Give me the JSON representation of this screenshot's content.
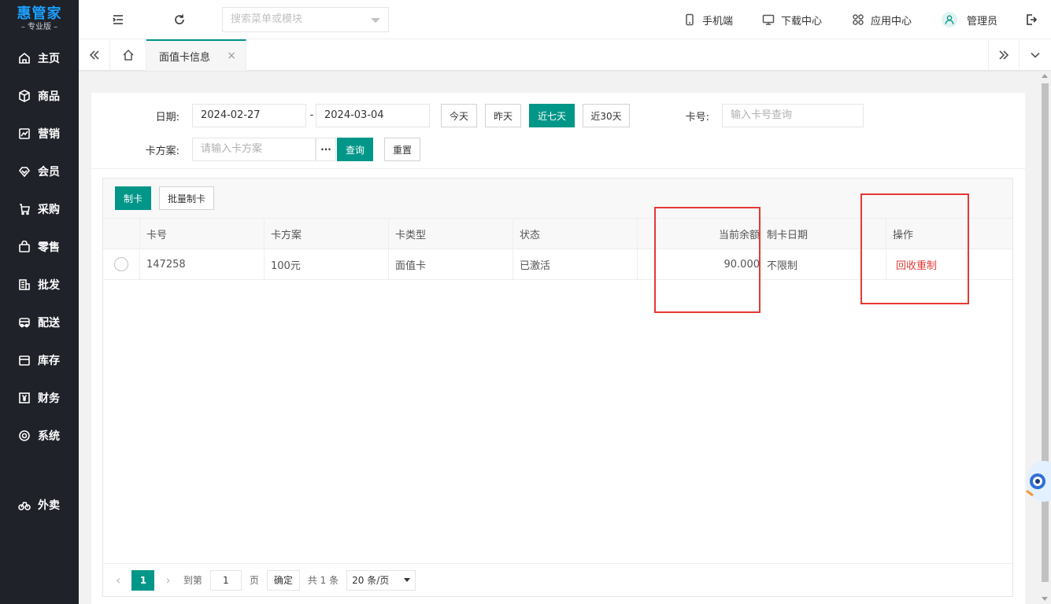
{
  "brand": {
    "name": "惠管家",
    "edition": "– 专业版 –",
    "accent": "#009688"
  },
  "sidebar": {
    "items": [
      {
        "label": "主页",
        "icon": "home-icon"
      },
      {
        "label": "商品",
        "icon": "cube-icon"
      },
      {
        "label": "营销",
        "icon": "chart-icon"
      },
      {
        "label": "会员",
        "icon": "diamond-icon"
      },
      {
        "label": "采购",
        "icon": "cart-icon"
      },
      {
        "label": "零售",
        "icon": "bag-icon"
      },
      {
        "label": "批发",
        "icon": "building-icon"
      },
      {
        "label": "配送",
        "icon": "truck-icon"
      },
      {
        "label": "库存",
        "icon": "box-icon"
      },
      {
        "label": "财务",
        "icon": "yen-icon"
      },
      {
        "label": "系统",
        "icon": "gear-icon"
      },
      {
        "label": "外卖",
        "icon": "bike-icon"
      }
    ]
  },
  "header": {
    "search_placeholder": "搜索菜单或模块",
    "mobile": "手机端",
    "download": "下载中心",
    "apps": "应用中心",
    "user": "管理员"
  },
  "tabs": {
    "active": "面值卡信息",
    "close": "×"
  },
  "filters": {
    "date_label": "日期:",
    "date_from": "2024-02-27",
    "date_sep": "-",
    "date_to": "2024-03-04",
    "today": "今天",
    "yesterday": "昨天",
    "last7": "近七天",
    "last30": "近30天",
    "card_no_label": "卡号:",
    "card_no_placeholder": "输入卡号查询",
    "plan_label": "卡方案:",
    "plan_placeholder": "请输入卡方案",
    "more": "···",
    "query": "查询",
    "reset": "重置"
  },
  "toolbar": {
    "make_card": "制卡",
    "batch_make": "批量制卡"
  },
  "table": {
    "columns": [
      "卡号",
      "卡方案",
      "卡类型",
      "状态",
      "当前余额",
      "制卡日期",
      "操作"
    ],
    "rows": [
      {
        "card_no": "147258",
        "plan": "100元",
        "type": "面值卡",
        "status": "已激活",
        "balance": "90.000",
        "date": "不限制",
        "action": "回收重制"
      }
    ]
  },
  "pager": {
    "current": "1",
    "goto_label": "到第",
    "goto_value": "1",
    "page_unit": "页",
    "confirm": "确定",
    "total": "共 1 条",
    "page_size": "20 条/页"
  }
}
